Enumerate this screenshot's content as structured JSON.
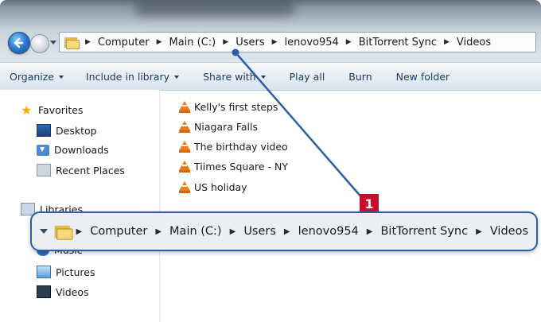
{
  "address_bar": {
    "crumbs": [
      "Computer",
      "Main (C:)",
      "Users",
      "lenovo954",
      "BitTorrent Sync",
      "Videos"
    ]
  },
  "toolbar": {
    "organize": "Organize",
    "include_in_library": "Include in library",
    "share_with": "Share with",
    "play_all": "Play all",
    "burn": "Burn",
    "new_folder": "New folder"
  },
  "nav": {
    "favorites": "Favorites",
    "desktop": "Desktop",
    "downloads": "Downloads",
    "recent_places": "Recent Places",
    "libraries": "Libraries",
    "music": "Music",
    "pictures": "Pictures",
    "videos": "Videos"
  },
  "files": [
    "Kelly's first steps",
    "Niagara Falls",
    "The birthday video",
    "Tiimes Square - NY",
    "US holiday"
  ],
  "callout": {
    "number": "1",
    "crumbs": [
      "Computer",
      "Main (C:)",
      "Users",
      "lenovo954",
      "BitTorrent Sync",
      "Videos"
    ]
  },
  "colors": {
    "callout_border": "#2a5fa7",
    "badge": "#c8102e",
    "vlc_icon": "#f07b15"
  },
  "icons": {
    "file": "vlc-cone-icon",
    "favorites": "star-icon"
  }
}
